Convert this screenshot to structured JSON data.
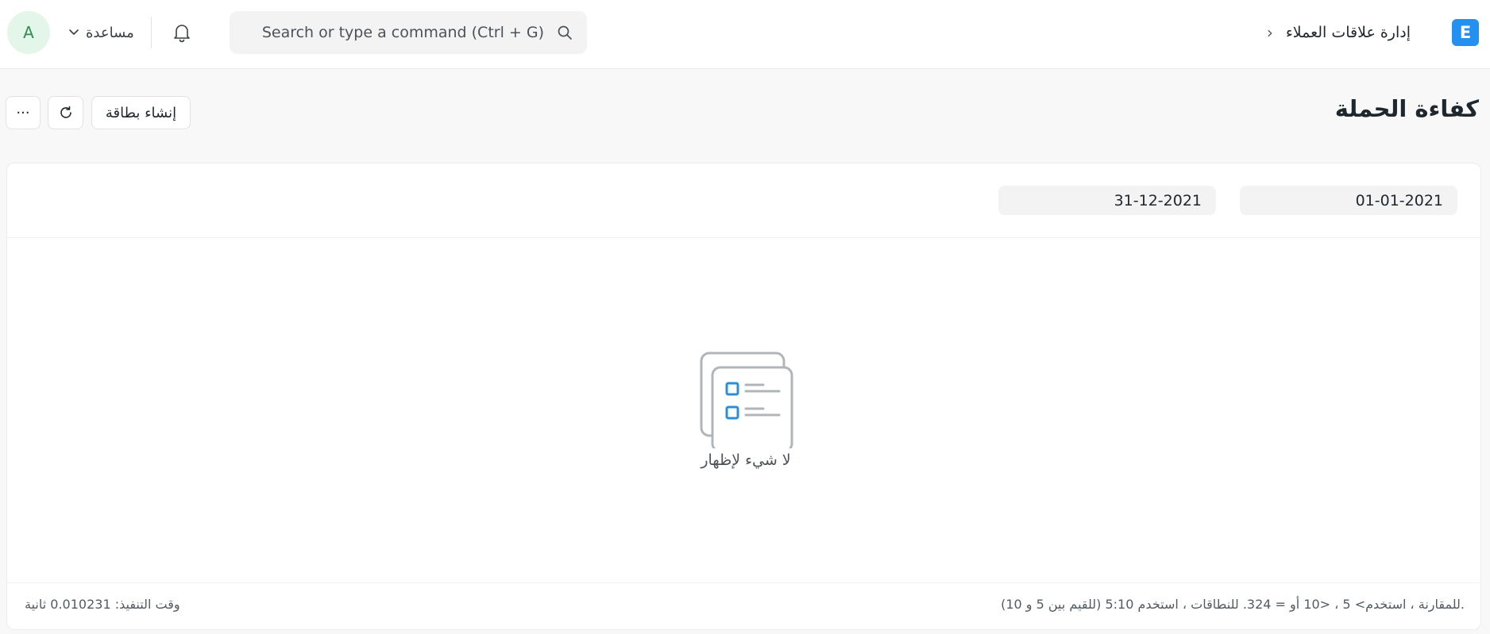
{
  "navbar": {
    "user_initial": "A",
    "help_label": "مساعدة",
    "search_placeholder": "Search or type a command (Ctrl + G)",
    "breadcrumb_module": "إدارة علاقات العملاء",
    "breadcrumb_separator": "›",
    "app_logo_letter": "E"
  },
  "page": {
    "title": "كفاءة الحملة",
    "buttons": {
      "create_card": "إنشاء بطاقة",
      "more": "···"
    }
  },
  "filters": {
    "from_date": "01-01-2021",
    "to_date": "31-12-2021"
  },
  "empty_state": {
    "message": "لا شيء لإظهار"
  },
  "footer": {
    "hint": "للمقارنة ، استخدم> 5 ، <10 أو = 324. للنطاقات ، استخدم 5:10 (للقيم بين 5 و 10).",
    "execution_time": "وقت التنفيذ: 0.010231 ثانية"
  },
  "icons": {
    "help_dropdown": "chevron-down-icon",
    "notifications": "bell-icon",
    "search": "search-icon",
    "refresh": "refresh-icon",
    "empty": "empty-list-icon"
  },
  "colors": {
    "brand": "#2490ef",
    "avatar_bg": "#e4f5e9",
    "avatar_text": "#2f8f4e"
  }
}
